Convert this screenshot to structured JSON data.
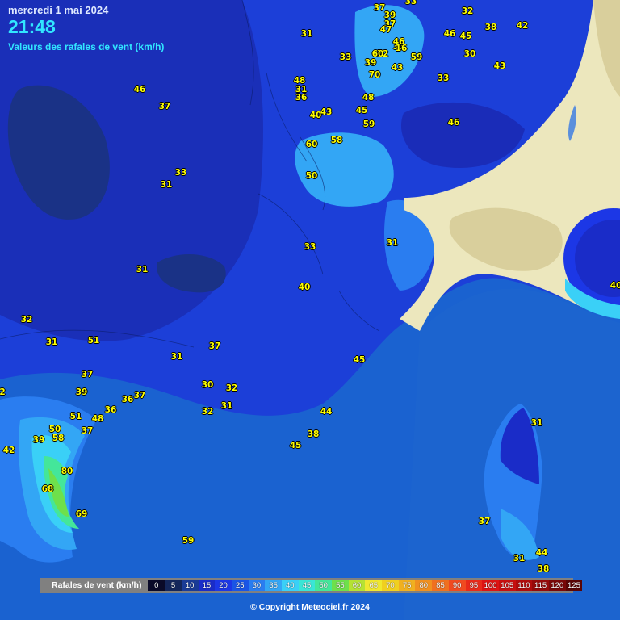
{
  "header": {
    "date": "mercredi 1 mai 2024",
    "time": "21:48",
    "subtitle": "Valeurs des rafales de vent (km/h)"
  },
  "legend": {
    "label": "Rafales de vent (km/h)",
    "steps": [
      {
        "label": "0",
        "color": "#0a0a28"
      },
      {
        "label": "5",
        "color": "#14265a"
      },
      {
        "label": "10",
        "color": "#1a3b96"
      },
      {
        "label": "15",
        "color": "#1a2cc8"
      },
      {
        "label": "20",
        "color": "#1c37e6"
      },
      {
        "label": "25",
        "color": "#1a55e6"
      },
      {
        "label": "30",
        "color": "#2a7df0"
      },
      {
        "label": "35",
        "color": "#33a6f5"
      },
      {
        "label": "40",
        "color": "#3ad0f7"
      },
      {
        "label": "45",
        "color": "#3ae6d6"
      },
      {
        "label": "50",
        "color": "#44e69a"
      },
      {
        "label": "55",
        "color": "#6ee04b"
      },
      {
        "label": "60",
        "color": "#b5e234"
      },
      {
        "label": "65",
        "color": "#f0e830"
      },
      {
        "label": "70",
        "color": "#f0d020"
      },
      {
        "label": "75",
        "color": "#f0b020"
      },
      {
        "label": "80",
        "color": "#f09020"
      },
      {
        "label": "85",
        "color": "#f07020"
      },
      {
        "label": "90",
        "color": "#f04a20"
      },
      {
        "label": "95",
        "color": "#e82a1a"
      },
      {
        "label": "100",
        "color": "#dd1414"
      },
      {
        "label": "105",
        "color": "#c80f0f"
      },
      {
        "label": "110",
        "color": "#b00c0c"
      },
      {
        "label": "115",
        "color": "#960a0a"
      },
      {
        "label": "120",
        "color": "#7a0808"
      },
      {
        "label": "125",
        "color": "#5a0606"
      }
    ]
  },
  "copyright": "© Copyright Meteociel.fr 2024",
  "stations": [
    {
      "v": "37"
    },
    {
      "v": "33"
    },
    {
      "v": "39"
    },
    {
      "v": "37"
    },
    {
      "v": "47"
    },
    {
      "v": "32"
    },
    {
      "v": "42"
    },
    {
      "v": "31"
    },
    {
      "v": "46"
    },
    {
      "v": "31"
    },
    {
      "v": "45"
    },
    {
      "v": "38"
    },
    {
      "v": "33"
    },
    {
      "v": "46"
    },
    {
      "v": "72"
    },
    {
      "v": "16"
    },
    {
      "v": "59"
    },
    {
      "v": "30"
    },
    {
      "v": "60"
    },
    {
      "v": "39"
    },
    {
      "v": "43"
    },
    {
      "v": "70"
    },
    {
      "v": "43"
    },
    {
      "v": "33"
    },
    {
      "v": "48"
    },
    {
      "v": "46"
    },
    {
      "v": "31"
    },
    {
      "v": "37"
    },
    {
      "v": "36"
    },
    {
      "v": "48"
    },
    {
      "v": "40"
    },
    {
      "v": "43"
    },
    {
      "v": "45"
    },
    {
      "v": "59"
    },
    {
      "v": "46"
    },
    {
      "v": "60"
    },
    {
      "v": "58"
    },
    {
      "v": "33"
    },
    {
      "v": "31"
    },
    {
      "v": "50"
    },
    {
      "v": "31"
    },
    {
      "v": "33"
    },
    {
      "v": "31"
    },
    {
      "v": "40"
    },
    {
      "v": "40"
    },
    {
      "v": "32"
    },
    {
      "v": "31"
    },
    {
      "v": "51"
    },
    {
      "v": "37"
    },
    {
      "v": "31"
    },
    {
      "v": "45"
    },
    {
      "v": "2"
    },
    {
      "v": "37"
    },
    {
      "v": "39"
    },
    {
      "v": "30"
    },
    {
      "v": "32"
    },
    {
      "v": "36"
    },
    {
      "v": "37"
    },
    {
      "v": "31"
    },
    {
      "v": "51"
    },
    {
      "v": "48"
    },
    {
      "v": "32"
    },
    {
      "v": "44"
    },
    {
      "v": "36"
    },
    {
      "v": "50"
    },
    {
      "v": "39"
    },
    {
      "v": "58"
    },
    {
      "v": "37"
    },
    {
      "v": "38"
    },
    {
      "v": "42"
    },
    {
      "v": "45"
    },
    {
      "v": "80"
    },
    {
      "v": "68"
    },
    {
      "v": "31"
    },
    {
      "v": "69"
    },
    {
      "v": "59"
    },
    {
      "v": "37"
    },
    {
      "v": "31"
    },
    {
      "v": "44"
    },
    {
      "v": "38"
    }
  ]
}
